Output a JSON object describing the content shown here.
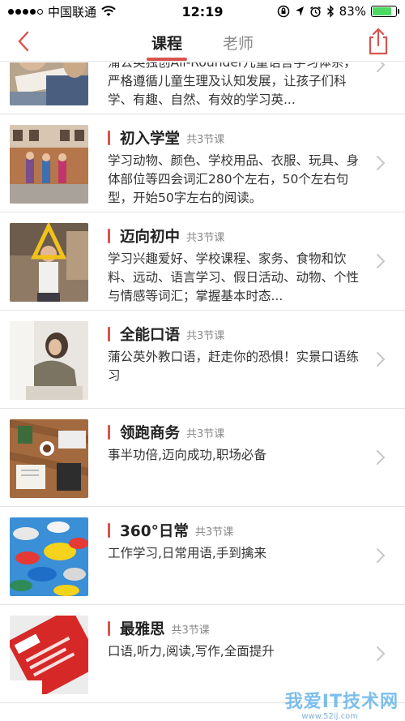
{
  "status_bar": {
    "carrier": "中国联通",
    "time": "12:19",
    "battery": "83%",
    "battery_level": 0.83
  },
  "nav": {
    "tabs": [
      {
        "label": "课程",
        "active": true
      },
      {
        "label": "老师",
        "active": false
      }
    ],
    "accent_color": "#d9534f"
  },
  "courses": [
    {
      "title": "",
      "count": "",
      "desc": "蒲公英独创All-Rounder儿童语言学习体系，严格遵循儿童生理及认知发展，让孩子们科学、有趣、自然、有效的学习英..."
    },
    {
      "title": "初入学堂",
      "count": "共3节课",
      "desc": "学习动物、颜色、学校用品、衣服、玩具、身体部位等四会词汇280个左右，50个左右句型，开始50字左右的阅读。"
    },
    {
      "title": "迈向初中",
      "count": "共3节课",
      "desc": "学习兴趣爱好、学校课程、家务、食物和饮料、远动、语言学习、假日活动、动物、个性与情感等词汇；掌握基本时态..."
    },
    {
      "title": "全能口语",
      "count": "共3节课",
      "desc": "蒲公英外教口语，赶走你的恐惧！实景口语练习"
    },
    {
      "title": "领跑商务",
      "count": "共3节课",
      "desc": "事半功倍,迈向成功,职场必备"
    },
    {
      "title": "360°日常",
      "count": "共3节课",
      "desc": "工作学习,日常用语,手到擒来"
    },
    {
      "title": "最雅思",
      "count": "共3节课",
      "desc": "口语,听力,阅读,写作,全面提升"
    }
  ],
  "watermark": {
    "text": "我爱IT技术网",
    "url": "www.52ij.com"
  }
}
